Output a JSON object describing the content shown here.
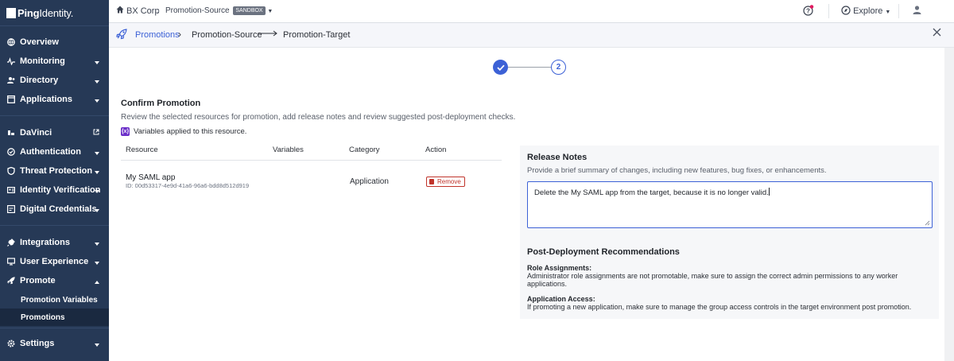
{
  "app": {
    "logo_bold": "Ping",
    "logo_rest": "Identity."
  },
  "topbar": {
    "org": "BX Corp",
    "environment": "Promotion-Source",
    "env_badge": "SANDBOX",
    "explore_label": "Explore"
  },
  "sidebar": {
    "items": [
      {
        "label": "Overview",
        "icon": "globe-icon"
      },
      {
        "label": "Monitoring",
        "icon": "pulse-icon"
      },
      {
        "label": "Directory",
        "icon": "users-icon"
      },
      {
        "label": "Applications",
        "icon": "window-icon"
      },
      {
        "label": "DaVinci",
        "icon": "davinci-icon"
      },
      {
        "label": "Authentication",
        "icon": "check-circle-icon"
      },
      {
        "label": "Threat Protection",
        "icon": "shield-icon"
      },
      {
        "label": "Identity Verification",
        "icon": "id-card-icon"
      },
      {
        "label": "Digital Credentials",
        "icon": "credential-icon"
      },
      {
        "label": "Integrations",
        "icon": "plug-icon"
      },
      {
        "label": "User Experience",
        "icon": "monitor-icon"
      },
      {
        "label": "Promote",
        "icon": "rocket-icon"
      },
      {
        "label": "Settings",
        "icon": "gear-icon"
      }
    ],
    "sub_items": [
      "Promotion Variables",
      "Promotions"
    ]
  },
  "header": {
    "breadcrumb_root": "Promotions",
    "source": "Promotion-Source",
    "target": "Promotion-Target"
  },
  "stepper": {
    "current_step": "2"
  },
  "confirm": {
    "title": "Confirm Promotion",
    "description": "Review the selected resources for promotion, add release notes and review suggested post-deployment checks.",
    "variables_icon_text": "{x}",
    "variables_note": "Variables applied to this resource.",
    "columns": [
      "Resource",
      "Variables",
      "Category",
      "Action"
    ],
    "rows": [
      {
        "name": "My SAML app",
        "id": "ID: 00d53317-4e9d-41a6-96a6-bdd8d512d919",
        "category": "Application",
        "action": "Remove"
      }
    ]
  },
  "release_notes": {
    "title": "Release Notes",
    "description": "Provide a brief summary of changes, including new features, bug fixes, or enhancements.",
    "value": "Delete the My SAML app from the target, because it is no longer valid."
  },
  "recommendations": {
    "title": "Post-Deployment Recommendations",
    "items": [
      {
        "label": "Role Assignments:",
        "text": "Administrator role assignments are not promotable, make sure to assign the correct admin permissions to any worker applications."
      },
      {
        "label": "Application Access:",
        "text": "If promoting a new application, make sure to manage the group access controls in the target environment post promotion."
      }
    ]
  },
  "colors": {
    "sidebar_bg": "#263956",
    "accent": "#3c61d6",
    "danger": "#c0342b",
    "variable_badge": "#6a2ec8"
  }
}
